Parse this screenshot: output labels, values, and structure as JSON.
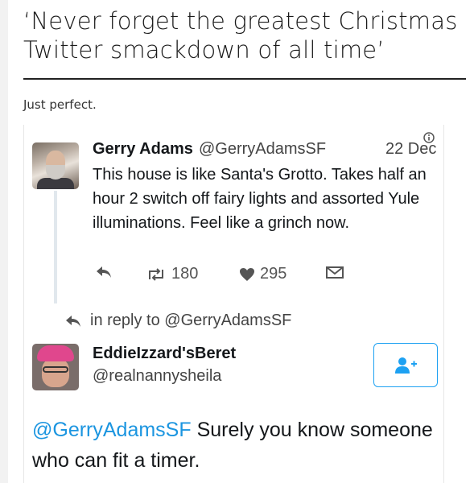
{
  "article": {
    "headline": "‘Never forget the greatest Christmas Twitter smackdown of all time’",
    "caption": "Just perfect."
  },
  "tweet1": {
    "author_name": "Gerry Adams",
    "handle": "@GerryAdamsSF",
    "date": "22 Dec",
    "text": "This house is like Santa's Grotto. Takes half an hour 2 switch off fairy lights and assorted Yule illuminations. Feel like a grinch now.",
    "retweets": "180",
    "likes": "295"
  },
  "reply_context": {
    "label": "in reply to @GerryAdamsSF"
  },
  "tweet2": {
    "author_name": "EddieIzzard'sBeret",
    "handle": "@realnannysheila",
    "mention": "@GerryAdamsSF",
    "text_rest": " Surely you know someone who can fit a timer."
  },
  "colors": {
    "accent": "#1da1f2",
    "heart": "#555555"
  },
  "icons": [
    "reply-icon",
    "retweet-icon",
    "heart-icon",
    "dm-icon",
    "follow-user-icon",
    "info-icon"
  ]
}
